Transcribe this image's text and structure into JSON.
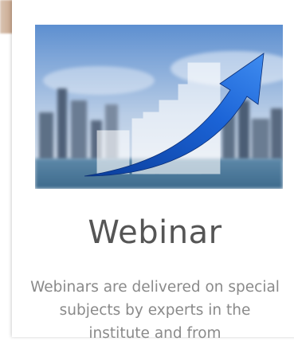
{
  "card": {
    "image_alt": "Business growth chart over city skyline",
    "title": "Webinar",
    "description": "Webinars are delivered on special subjects by experts in the institute and from"
  }
}
